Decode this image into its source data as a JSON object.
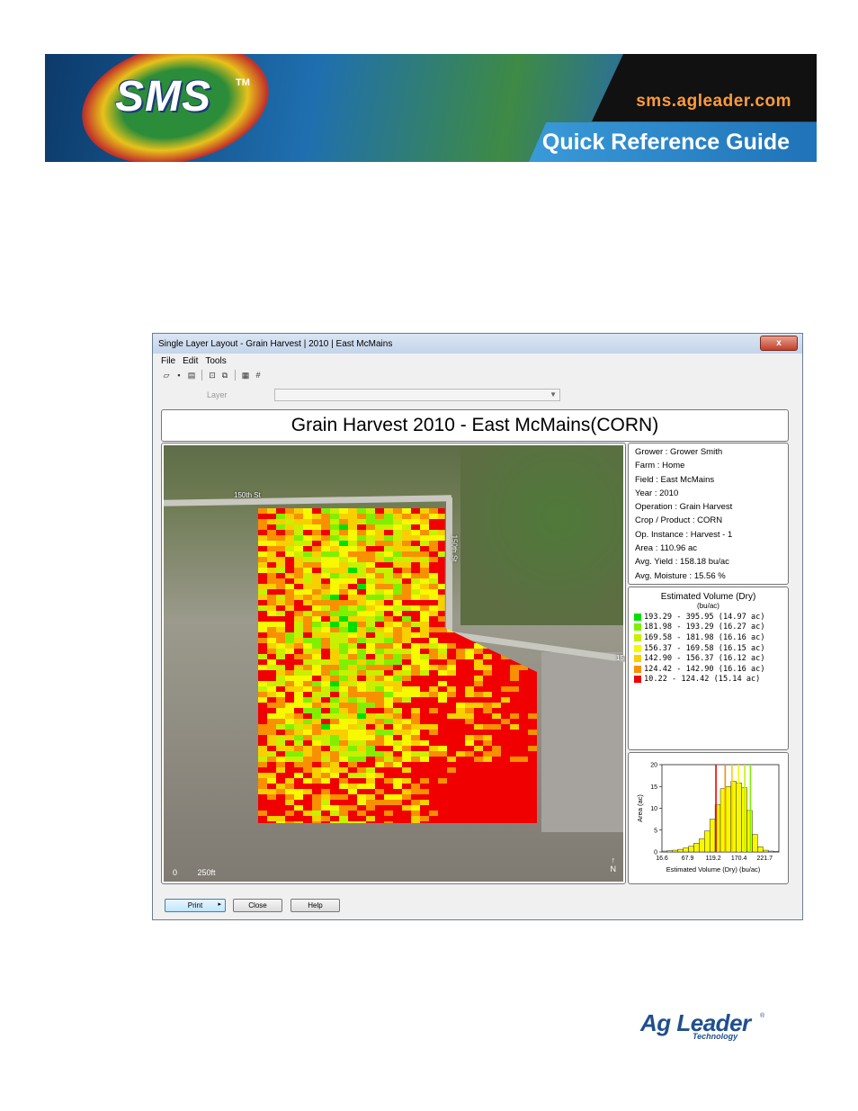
{
  "banner": {
    "logo_text": "SMS",
    "logo_tm": "TM",
    "url": "sms.agleader.com",
    "guide_title": "Quick Reference Guide"
  },
  "window": {
    "title": "Single Layer Layout - Grain Harvest | 2010 | East McMains",
    "close_glyph": "x",
    "menu": [
      "File",
      "Edit",
      "Tools"
    ],
    "toolbar_icons": [
      "open-icon",
      "save-icon",
      "print-icon",
      "zoom-icon",
      "copy-icon",
      "grid-icon",
      "grid-alt-icon"
    ],
    "layer_label": "Layer",
    "layer_value": "",
    "layout_title": "Grain Harvest 2010 - East McMains(CORN)",
    "map": {
      "road_label_h": "150th St",
      "road_label_v": "150th St",
      "road_label_e": "15",
      "scale_zero": "0",
      "scale_distance": "250ft",
      "north_label": "N"
    },
    "info": [
      "Grower : Grower Smith",
      "Farm  : Home",
      "Field  : East McMains",
      "Year : 2010",
      "Operation  : Grain Harvest",
      "Crop / Product : CORN",
      "Op. Instance : Harvest - 1",
      "Area : 110.96 ac",
      "Avg. Yield : 158.18 bu/ac",
      "Avg. Moisture : 15.56 %"
    ],
    "legend": {
      "title": "Estimated Volume (Dry)",
      "unit": "(bu/ac)",
      "rows": [
        {
          "text": "193.29 - 395.95 (14.97 ac)",
          "color": "#00e000"
        },
        {
          "text": "181.98 - 193.29 (16.27 ac)",
          "color": "#80f000"
        },
        {
          "text": "169.58 - 181.98 (16.16 ac)",
          "color": "#c8f000"
        },
        {
          "text": "156.37 - 169.58 (16.15 ac)",
          "color": "#f8f800"
        },
        {
          "text": "142.90 - 156.37 (16.12 ac)",
          "color": "#f8d000"
        },
        {
          "text": "124.42 - 142.90 (16.16 ac)",
          "color": "#f89000"
        },
        {
          "text": " 10.22 - 124.42 (15.14 ac)",
          "color": "#f00000"
        }
      ]
    },
    "buttons": {
      "print": "Print",
      "print_arrow": "▸",
      "close": "Close",
      "help": "Help"
    }
  },
  "chart_data": {
    "type": "bar",
    "title": "",
    "xlabel": "Estimated Volume (Dry) (bu/ac)",
    "ylabel": "Area (ac)",
    "ylim": [
      0,
      20
    ],
    "yticks": [
      "0",
      "5",
      "10",
      "15",
      "20"
    ],
    "xticks": [
      "16.6",
      "67.9",
      "119.2",
      "170.4",
      "221.7"
    ],
    "values": [
      0.2,
      0.3,
      0.4,
      0.6,
      0.9,
      1.3,
      2.0,
      3.0,
      4.8,
      7.5,
      10.8,
      14.5,
      15.0,
      16.2,
      15.8,
      14.7,
      9.5,
      4.0,
      1.2,
      0.4,
      0.2,
      0.1
    ],
    "bar_colors": [
      "#f8f800",
      "#f8f800",
      "#f8f800",
      "#f8f800",
      "#f8f800",
      "#f8f800",
      "#f8f800",
      "#f8f800",
      "#f8f800",
      "#f8f800",
      "#f8f800",
      "#f8f800",
      "#f8f800",
      "#f8f800",
      "#f8f800",
      "#f8f800",
      "#f8f800",
      "#f8f800",
      "#f8f800",
      "#f8f800",
      "#f8f800",
      "#f8f800"
    ],
    "class_breaks": [
      {
        "value": 124.42,
        "color": "#f00000"
      },
      {
        "value": 142.9,
        "color": "#f89000"
      },
      {
        "value": 156.37,
        "color": "#f8d000"
      },
      {
        "value": 169.58,
        "color": "#f8f800"
      },
      {
        "value": 181.98,
        "color": "#c8f000"
      },
      {
        "value": 193.29,
        "color": "#80f000"
      }
    ],
    "xrange": [
      16.6,
      250
    ]
  },
  "footer": {
    "brand_main": "Ag Leader",
    "brand_reg": "®",
    "brand_sub": "Technology"
  }
}
